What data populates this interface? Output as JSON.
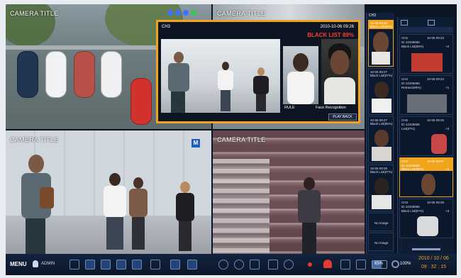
{
  "cameras": [
    {
      "title": "CAMERA TITLE"
    },
    {
      "title": "CAMERA TITLE"
    },
    {
      "title": "CAMERA TITLE"
    },
    {
      "title": "CAMERA TITLE"
    }
  ],
  "popup": {
    "channel": "CH3",
    "timestamp": "2010-10-06 09:26",
    "status": "BLACK LIST 89%",
    "rule_label": "RULE",
    "detection_label": "Face Recognition",
    "playback_label": "PLAY BACK"
  },
  "detection_panel": {
    "header": "CH3",
    "items": [
      {
        "time": "10-06 09:26",
        "match": "Black List(89%)",
        "highlight": true
      },
      {
        "time": "10-06 09:27",
        "match": "Black List(87%)",
        "highlight": false
      },
      {
        "time": "10-06 09:27",
        "match": "Black List(85%)",
        "highlight": false
      },
      {
        "time": "10-06 09:28",
        "match": "Black List(87%)",
        "highlight": false
      }
    ],
    "no_image": [
      "No Image",
      "No Image"
    ]
  },
  "side_panel": {
    "items": [
      {
        "ch": "CH2",
        "time": "10-06 09:22",
        "id": "ID 12345656",
        "status": "Black List(89%)",
        "count": "+2",
        "highlight": false
      },
      {
        "ch": "CH4",
        "time": "10-06 09:23",
        "id": "ID 12345656",
        "status": "Retrace(89%)",
        "count": "+1",
        "highlight": false
      },
      {
        "ch": "CH5",
        "time": "10-06 09:25",
        "id": "ID 12345656",
        "status": "List(87%)",
        "count": "+3",
        "highlight": false
      },
      {
        "ch": "CH3",
        "time": "10-06 09:27",
        "id": "ID 12345656",
        "status": "Black List(89%)",
        "count": "+4",
        "highlight": true
      },
      {
        "ch": "CH3",
        "time": "10-06 09:28",
        "id": "ID 12345656",
        "status": "Black List(87%)",
        "count": "+3",
        "highlight": false
      }
    ]
  },
  "toolbar": {
    "menu_label": "MENU",
    "user_label": "ADMIN",
    "storage_label": "65%",
    "disk_label": "100%",
    "date": "2010 / 10 / 06",
    "time": "09 : 32 : 15"
  },
  "colors": {
    "accent": "#f2a31c",
    "alert": "#ff3b30",
    "toolbar_bg": "#0a1628",
    "panel_bg": "#0f1d33",
    "text": "#ffffff"
  }
}
